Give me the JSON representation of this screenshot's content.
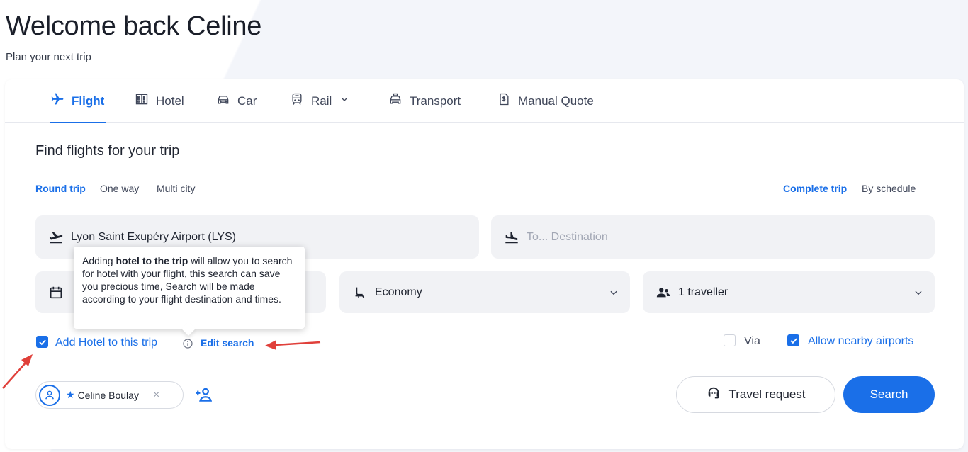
{
  "header": {
    "title": "Welcome back Celine",
    "subtitle": "Plan your next trip"
  },
  "tabs": [
    {
      "label": "Flight",
      "icon": "plane-icon",
      "active": true
    },
    {
      "label": "Hotel",
      "icon": "building-icon"
    },
    {
      "label": "Car",
      "icon": "car-icon"
    },
    {
      "label": "Rail",
      "icon": "train-icon"
    },
    {
      "label": "Transport",
      "icon": "taxi-icon"
    },
    {
      "label": "Manual Quote",
      "icon": "document-dollar-icon"
    }
  ],
  "search": {
    "title": "Find flights for your trip",
    "trip_types": [
      "Round trip",
      "One way",
      "Multi city"
    ],
    "trip_type_selected": "Round trip",
    "modes": [
      "Complete trip",
      "By schedule"
    ],
    "mode_selected": "Complete trip",
    "origin": "Lyon Saint Exupéry Airport (LYS)",
    "destination_placeholder": "To... Destination",
    "cabin": "Economy",
    "travellers": "1 traveller"
  },
  "tooltip": {
    "prefix": "Adding ",
    "bold": "hotel to the trip",
    "suffix": " will allow you to search for hotel with your flight, this search can save you precious time, Search will be made according to your flight destination and times."
  },
  "options": {
    "add_hotel_label": "Add Hotel to this trip",
    "add_hotel_checked": true,
    "edit_search_label": "Edit search",
    "via_label": "Via",
    "via_checked": false,
    "nearby_label": "Allow nearby airports",
    "nearby_checked": true
  },
  "traveller_chip": {
    "name": "Celine Boulay",
    "remove_glyph": "×"
  },
  "actions": {
    "travel_request_label": "Travel request",
    "search_label": "Search"
  },
  "colors": {
    "accent": "#1a6fe8",
    "annotation_arrow": "#e0403a"
  }
}
